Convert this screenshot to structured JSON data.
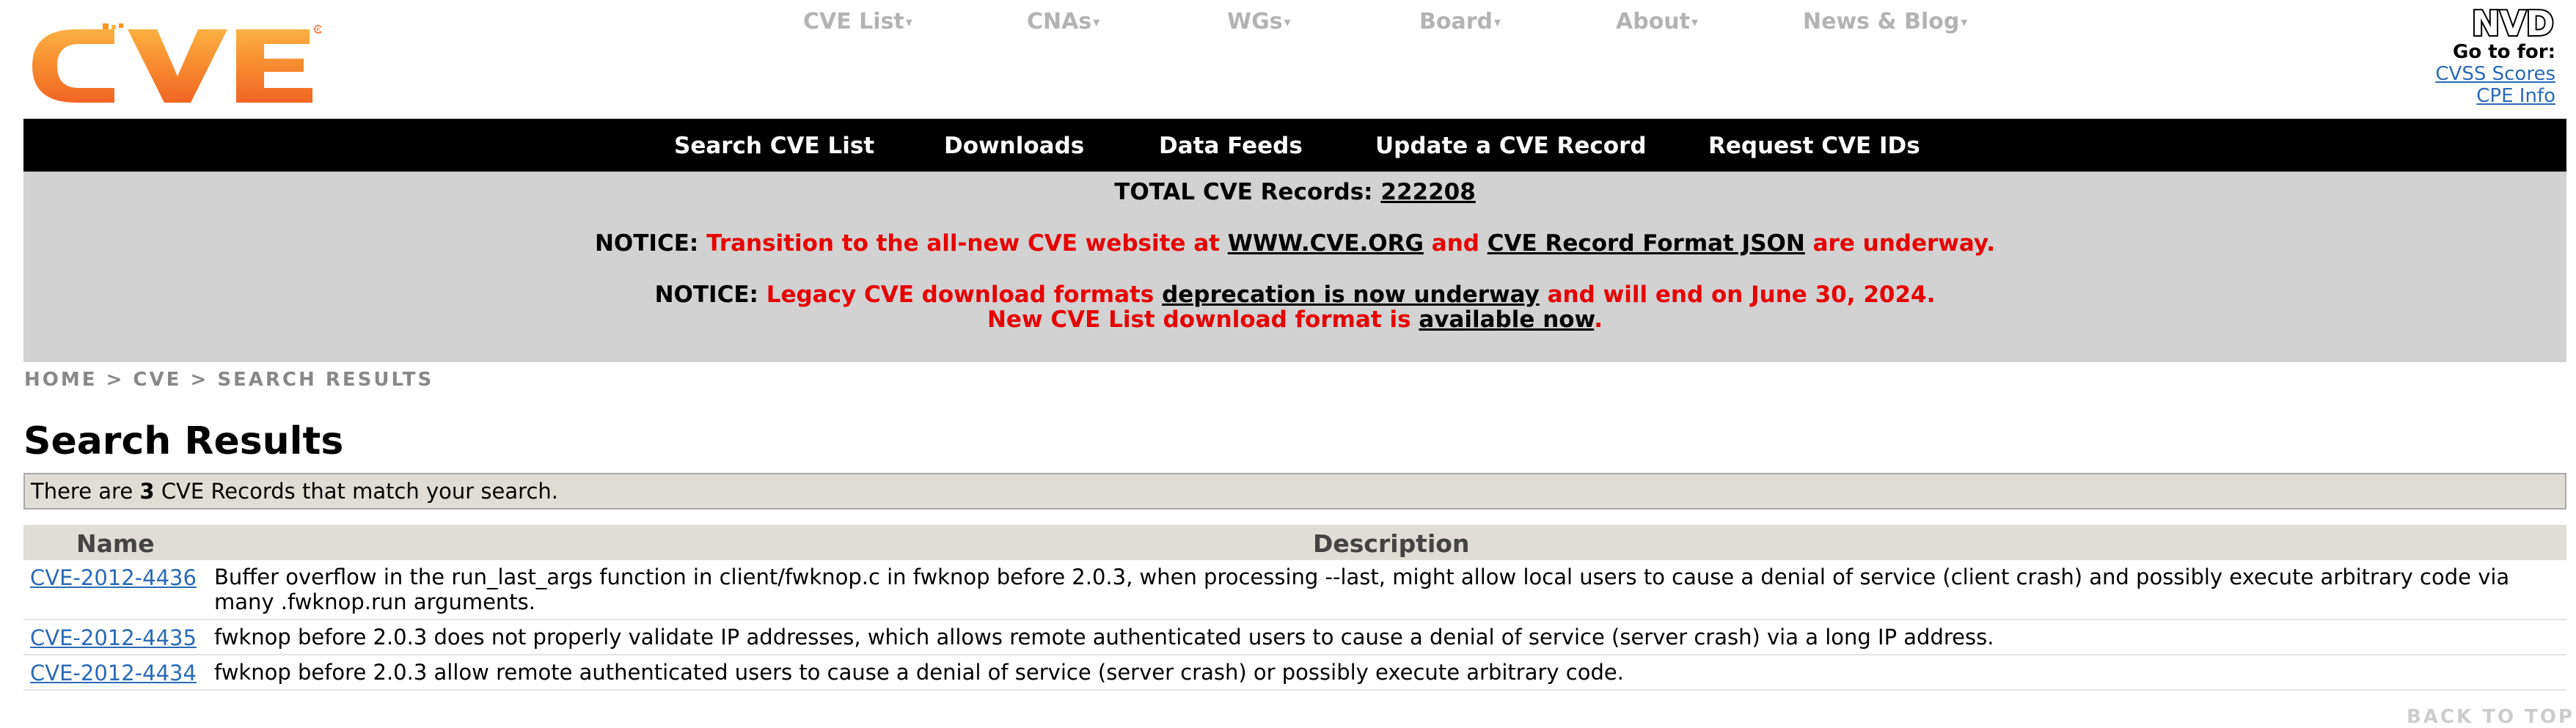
{
  "logo_text": "CVE",
  "top_nav": [
    {
      "label": "CVE List"
    },
    {
      "label": "CNAs"
    },
    {
      "label": "WGs"
    },
    {
      "label": "Board"
    },
    {
      "label": "About"
    },
    {
      "label": "News & Blog"
    }
  ],
  "nvd": {
    "logo_text": "NVD",
    "goto_label": "Go to for:",
    "links": [
      "CVSS Scores",
      "CPE Info"
    ]
  },
  "menu": [
    {
      "label": "Search CVE List"
    },
    {
      "label": "Downloads"
    },
    {
      "label": "Data Feeds"
    },
    {
      "label": "Update a CVE Record"
    },
    {
      "label": "Request CVE IDs"
    }
  ],
  "notices": {
    "total_label": "TOTAL CVE Records:",
    "total_value": "222208",
    "notice1": {
      "prefix": "NOTICE:",
      "text1": "Transition to the all-new CVE website at",
      "link1": "WWW.CVE.ORG",
      "text2": "and",
      "link2": "CVE Record Format JSON",
      "text3": "are underway."
    },
    "notice2": {
      "prefix": "NOTICE:",
      "text1": "Legacy CVE download formats",
      "link1": "deprecation is now underway",
      "text2": "and will end on June 30, 2024.",
      "line2_text": "New CVE List download format is",
      "link2": "available now",
      "line2_end": "."
    }
  },
  "breadcrumb": [
    "HOME",
    ">",
    "CVE",
    ">",
    "SEARCH RESULTS"
  ],
  "page_title": "Search Results",
  "match": {
    "prefix": "There are",
    "count": "3",
    "suffix": "CVE Records that match your search."
  },
  "table": {
    "headers": {
      "name": "Name",
      "description": "Description"
    },
    "rows": [
      {
        "id": "CVE-2012-4436",
        "description": "Buffer overflow in the run_last_args function in client/fwknop.c in fwknop before 2.0.3, when processing --last, might allow local users to cause a denial of service (client crash) and possibly execute arbitrary code via many .fwknop.run arguments."
      },
      {
        "id": "CVE-2012-4435",
        "description": "fwknop before 2.0.3 does not properly validate IP addresses, which allows remote authenticated users to cause a denial of service (server crash) via a long IP address."
      },
      {
        "id": "CVE-2012-4434",
        "description": "fwknop before 2.0.3 allow remote authenticated users to cause a denial of service (server crash) or possibly execute arbitrary code."
      }
    ]
  },
  "back_to_top": "BACK TO TOP",
  "colors": {
    "brand_orange": "#f7941d",
    "notice_red": "#e60000",
    "link_blue": "#2a6ab6",
    "menu_bg": "#000000",
    "notice_bg": "#d2d2d2"
  }
}
